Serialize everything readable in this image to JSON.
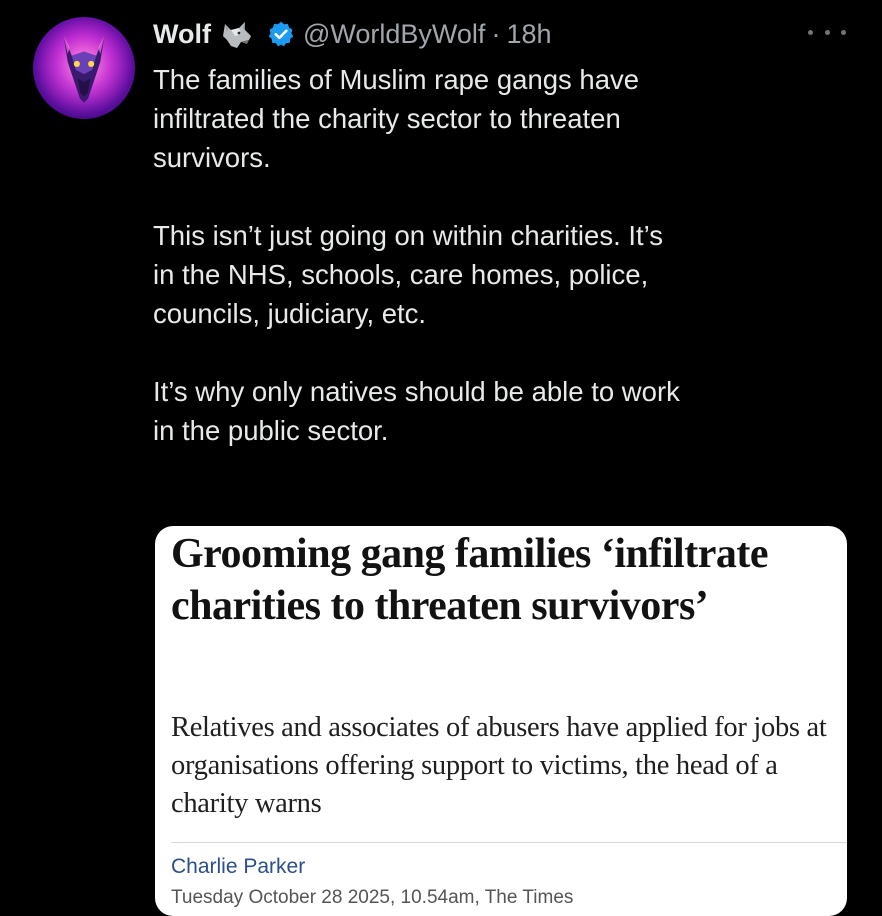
{
  "tweet": {
    "display_name": "Wolf",
    "name_emoji": "wolf-emoji",
    "verified_badge": "verified-badge-icon",
    "handle": "@WorldByWolf",
    "separator": "·",
    "timestamp": "18h",
    "more_menu_icon": "more-horizontal-icon",
    "avatar_icon": "wolf-avatar",
    "text": "The families of Muslim rape gangs have\ninfiltrated the charity sector to threaten\nsurvivors.\n\nThis isn’t just going on within charities. It’s\nin the NHS, schools, care homes, police,\ncouncils, judiciary, etc.\n\nIt’s why only natives should be able to work\nin the public sector."
  },
  "article_card": {
    "headline": "Grooming gang families ‘infiltrate charities to threaten survivors’",
    "standfirst": "Relatives and associates of abusers have applied for jobs at organisations offering support to victims, the head of a charity warns",
    "author": "Charlie Parker",
    "dateline": "Tuesday October 28 2025, 10.54am, The Times"
  },
  "colors": {
    "background": "#000000",
    "primary_text": "#e7e9ea",
    "secondary_text": "#a0a6ab",
    "verified_blue": "#1d9bf0",
    "card_background": "#ffffff",
    "author_link": "#2b4f8a"
  }
}
